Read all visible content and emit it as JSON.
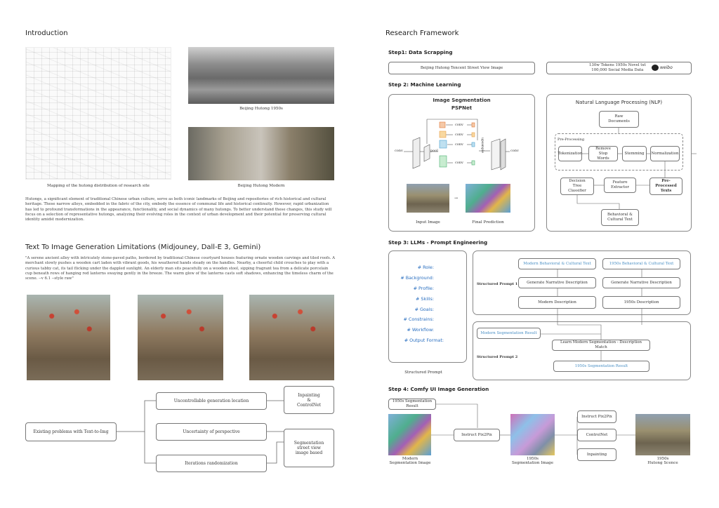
{
  "left": {
    "intro_title": "Introduction",
    "caption_map": "Mapping of the hutong distribution of research site",
    "caption_1950": "Beijing Hutong 1950s",
    "caption_modern": "Beijing Hutong Modern",
    "intro_text": "Hutongs, a significant element of traditional Chinese urban culture, serve as both iconic landmarks of Beijing and repositories of rich historical and cultural heritage. These narrow alleys, embedded in the fabric of the city, embody the essence of communal life and historical continuity. However, rapid urbanization has led to profound transformations in the appearance, functionality, and social dynamics of many hutongs. To better understand these changes, this study will focus on a selection of representative hutongs, analyzing their evolving roles in the context of urban development and their potential for preserving cultural identity amidst modernization.",
    "limits_title": "Text To Image Generation Limitations (Midjouney, Dall-E 3, Gemini)",
    "prompt_text": "\"A serene ancient alley with intricately stone-paved paths, bordered by traditional Chinese courtyard houses featuring ornate wooden carvings and tiled roofs. A merchant slowly pushes a wooden cart laden with vibrant goods, his weathered hands steady on the handles. Nearby, a cheerful child crouches to play with a curious tabby cat, its tail flicking under the dappled sunlight. An elderly man sits peacefully on a wooden stool, sipping fragrant tea from a delicate porcelain cup beneath rows of hanging red lanterns swaying gently in the breeze. The warm glow of the lanterns casts soft shadows, enhancing the timeless charm of the scene. --v 6.1 --style raw\"",
    "flow": {
      "problem": "Existing problems with Text-to-Img",
      "issue1": "Uncontrollable generation location",
      "issue2": "Uncertainty of perspective",
      "issue3": "Iterations randomization",
      "sol1": "Inpainting\n&\nControlNet",
      "sol2": "Segmentation\nstreet view\nimage based"
    }
  },
  "right": {
    "title": "Research Framework",
    "step1": "Step1: Data Scrapping",
    "step1_box1": "Beijing Hutong Tencent Street View Image",
    "step1_box2": "130w Tokens 1950s Novel txt\n100,000 Social Media Data",
    "weibo": "weibo",
    "step2": "Step 2: Machine Learning",
    "seg_title": "Image Segmentation",
    "seg_sub": "PSPNet",
    "conv": "conv",
    "pool": "pool",
    "upsample": "upsample",
    "concat": "concat",
    "input_image": "Input Image",
    "final_prediction": "Final Prediction",
    "nlp_title": "Natural Language Processing (NLP)",
    "raw_docs": "Raw\nDocuments",
    "preprocessing": "Pre-Processing",
    "tokenization": "Tokenization",
    "stopwords": "Remove Stop\nWords",
    "stemming": "Stemming",
    "normalization": "Normalization",
    "decision_tree": "Decision\nTree\nClassifier",
    "feature_extractor": "Feature\nExtractor",
    "preprocessed": "Pre-\nProcessed\nTexts",
    "behavioral": "Behavioral &\nCultural Text",
    "step3": "Step 3: LLMs - Prompt Engineering",
    "prompt_items": [
      "# Role:",
      "# Background:",
      "# Profile:",
      "# Skills:",
      "# Goals:",
      "# Constrains:",
      "# Workflow:",
      "# Output Format:"
    ],
    "structured_prompt": "Structured Prompt",
    "sp1": "Structured Prompt 1",
    "sp2": "Structured Prompt 2",
    "modern_bct": "Modern Behavioral & Cultural Text",
    "bct_1950": "1950s Behavioral & Cultural Text",
    "gen_narr": "Generate Narrative Description",
    "modern_desc": "Modern Description",
    "desc_1950": "1950s Description",
    "modern_seg_result": "Modern Segmentation Result",
    "learn_match": "Learn Modern Segmentation - Description Match",
    "seg_result_1950": "1950s Segmentation Result",
    "step4": "Step 4: Comfy UI Image Generation",
    "seg_result_1950b": "1950s Segmentation Result",
    "instruct_p2p": "Instruct Pix2Pix",
    "modern_seg_img": "Modern\nSegmentation Image",
    "seg_img_1950": "1950s\nSegmentation Image",
    "instruct_p2p2": "Instruct Pix2Pix",
    "controlnet": "ControlNet",
    "inpainting": "Inpainting",
    "hutong_scene": "1950s\nHutong Scence"
  },
  "colors": {
    "accent_blue": "#2a6fc0",
    "link_blue": "#4a8fc4"
  }
}
